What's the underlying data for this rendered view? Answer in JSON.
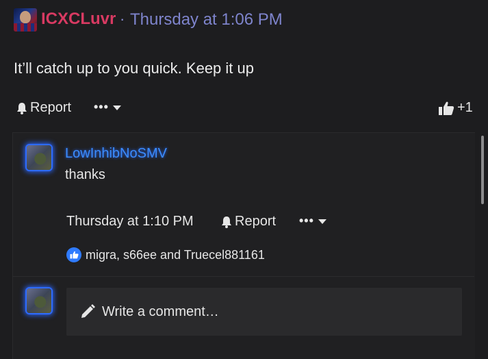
{
  "post": {
    "author": "ICXCLuvr",
    "separator": "·",
    "time": "Thursday at 1:06 PM",
    "body": "It’ll catch up to you quick. Keep it up",
    "report_label": "Report",
    "more_label": "•••",
    "like_count": "+1"
  },
  "reply": {
    "author": "LowInhibNoSMV",
    "text": "thanks",
    "time": "Thursday at 1:10 PM",
    "report_label": "Report",
    "more_label": "•••",
    "likes_text": "migra, s66ee and Truecel881161"
  },
  "comment": {
    "placeholder": "Write a comment…"
  },
  "colors": {
    "author": "#d83a62",
    "time": "#7e84cc",
    "reply_author": "#3b8dff",
    "like_badge": "#2f7bff",
    "background": "#1d1d1f"
  },
  "icons": [
    "bell-icon",
    "more-dots-icon",
    "chevron-down-icon",
    "thumbs-up-icon",
    "pencil-icon"
  ]
}
